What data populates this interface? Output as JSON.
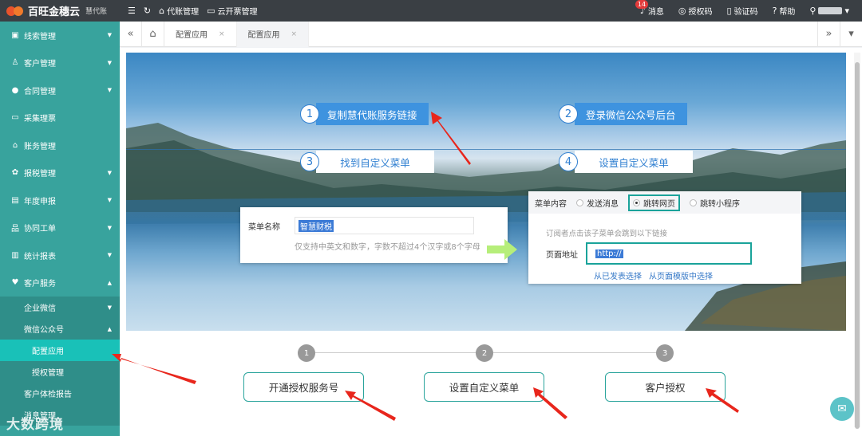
{
  "app": {
    "title": "百旺金穗云",
    "subtitle": "慧代账"
  },
  "topbar": {
    "menu_icon": "hamburger-icon",
    "refresh_icon": "refresh-icon",
    "agency_label": "代账管理",
    "invoice_label": "云开票管理",
    "messages_label": "消息",
    "messages_count": "14",
    "auth_code_label": "授权码",
    "verify_code_label": "验证码",
    "help_label": "帮助"
  },
  "sidebar": {
    "items": [
      {
        "label": "线索管理",
        "icon": "clue-icon"
      },
      {
        "label": "客户管理",
        "icon": "customer-icon"
      },
      {
        "label": "合同管理",
        "icon": "contract-icon"
      },
      {
        "label": "采集理票",
        "icon": "ticket-icon"
      },
      {
        "label": "账务管理",
        "icon": "ledger-icon"
      },
      {
        "label": "报税管理",
        "icon": "tax-icon"
      },
      {
        "label": "年度申报",
        "icon": "annual-icon"
      },
      {
        "label": "协同工单",
        "icon": "workorder-icon"
      },
      {
        "label": "统计报表",
        "icon": "report-icon"
      },
      {
        "label": "客户服务",
        "icon": "service-icon"
      }
    ],
    "sub": {
      "enterprise_wechat": "企业微信",
      "wechat_official": "微信公众号",
      "config_app": "配置应用",
      "auth_manage": "授权管理",
      "health_report": "客户体检报告",
      "msg_manage": "消息管理"
    },
    "watermark": "大数跨境"
  },
  "tabs": {
    "items": [
      {
        "label": "配置应用"
      },
      {
        "label": "配置应用"
      }
    ]
  },
  "guide": {
    "steps": [
      {
        "num": "1",
        "label": "复制慧代账服务链接"
      },
      {
        "num": "2",
        "label": "登录微信公众号后台"
      },
      {
        "num": "3",
        "label": "找到自定义菜单"
      },
      {
        "num": "4",
        "label": "设置自定义菜单"
      }
    ],
    "menu_name_label": "菜单名称",
    "menu_name_value": "智慧财税",
    "menu_name_hint": "仅支持中英文和数字，字数不超过4个汉字或8个字母",
    "menu_content_label": "菜单内容",
    "options": [
      "发送消息",
      "跳转网页",
      "跳转小程序"
    ],
    "selected_option": "跳转网页",
    "redirect_hint": "订阅者点击该子菜单会跳到以下链接",
    "page_url_label": "页面地址",
    "page_url_value": "http://",
    "link_published": "从已发表选择",
    "link_template": "从页面模版中选择"
  },
  "progress": {
    "nodes": [
      "1",
      "2",
      "3"
    ],
    "buttons": [
      "开通授权服务号",
      "设置自定义菜单",
      "客户授权"
    ]
  },
  "colors": {
    "sidebar": "#38a39d",
    "sidebar_active": "#19c1b8",
    "topbar": "#3a3f44",
    "accent_blue": "#3e93df",
    "teal_border": "#2aa49c",
    "arrow_red": "#e8261c"
  }
}
